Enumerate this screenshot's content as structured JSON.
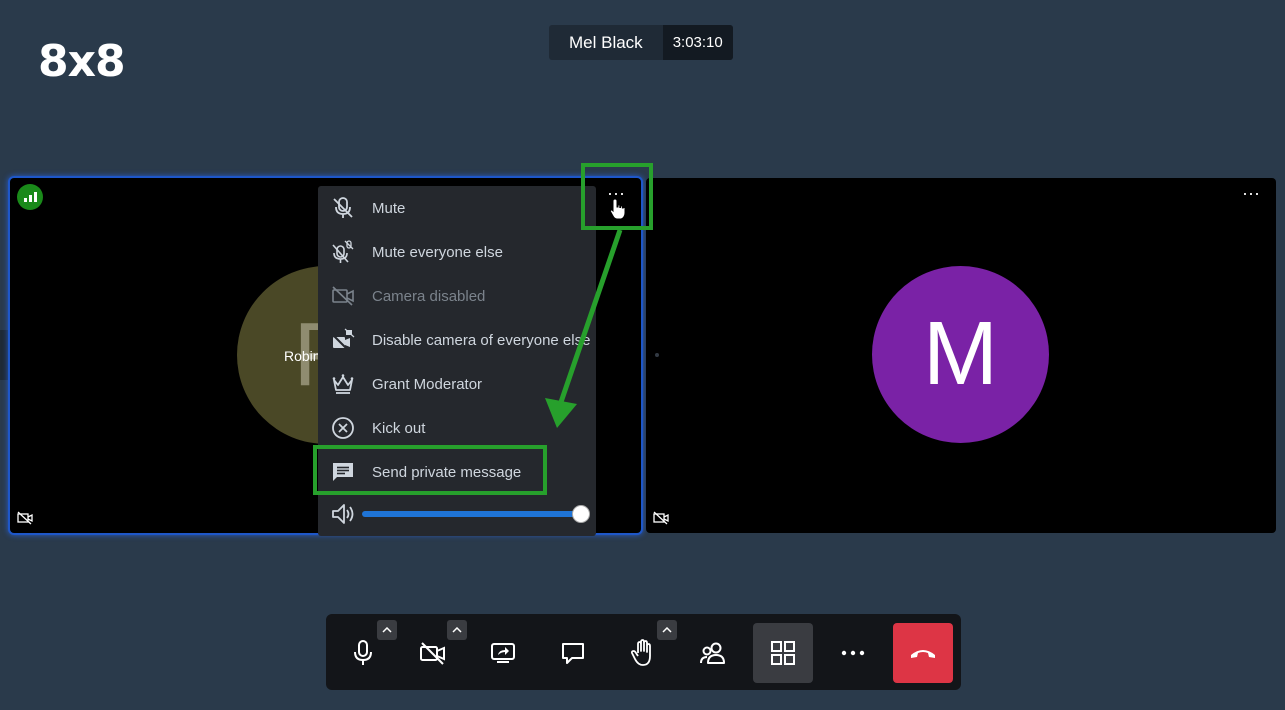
{
  "logo_text": "8x8",
  "header": {
    "name": "Mel Black",
    "timer": "3:03:10"
  },
  "local_tile": {
    "avatar_initial": "R",
    "display_name": "Robin"
  },
  "remote_tile": {
    "avatar_initial": "M",
    "avatar_color": "#7a22a6"
  },
  "context_menu": {
    "items": [
      {
        "label": "Mute",
        "icon": "mic-off-icon"
      },
      {
        "label": "Mute everyone else",
        "icon": "mic-off-all-icon"
      },
      {
        "label": "Camera disabled",
        "icon": "camera-off-icon",
        "disabled": true
      },
      {
        "label": "Disable camera of everyone else",
        "icon": "camera-off-all-icon"
      },
      {
        "label": "Grant Moderator",
        "icon": "crown-icon"
      },
      {
        "label": "Kick out",
        "icon": "kick-out-icon"
      },
      {
        "label": "Send private message",
        "icon": "message-icon"
      }
    ],
    "volume": 1.0
  },
  "colors": {
    "highlight": "#27a02c",
    "hangup": "#dd3545",
    "accent": "#1f74d6"
  },
  "toolbar": {
    "buttons": [
      "microphone",
      "camera",
      "screen-share",
      "chat",
      "raise-hand",
      "participants",
      "tile-view",
      "more",
      "hangup"
    ]
  }
}
